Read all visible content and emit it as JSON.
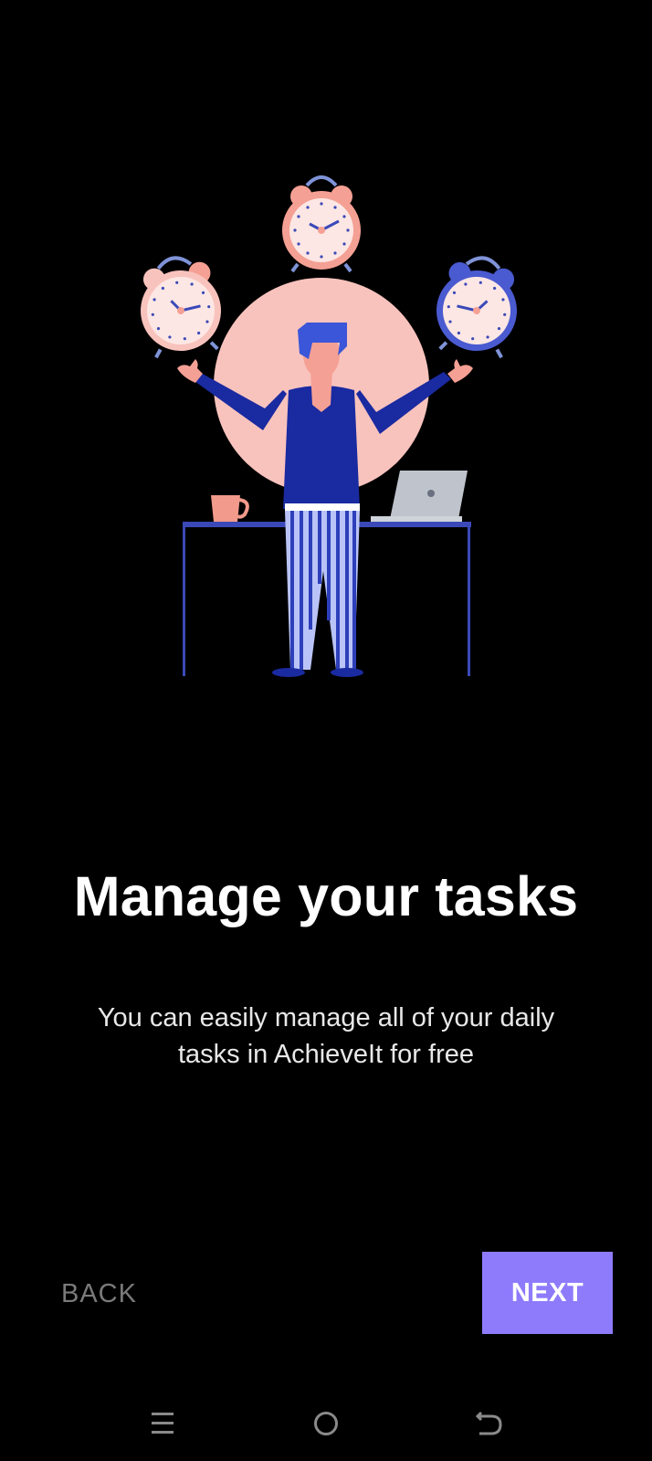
{
  "onboarding": {
    "title": "Manage your tasks",
    "subtitle": "You can easily manage all of your daily tasks in AchieveIt for free",
    "back_label": "BACK",
    "next_label": "NEXT"
  },
  "illustration": {
    "subject": "person-juggling-alarm-clocks-at-desk"
  },
  "navbar": {
    "icons": [
      "menu-icon",
      "home-icon",
      "back-icon"
    ]
  },
  "colors": {
    "background": "#000000",
    "accent": "#8e7bfb",
    "title": "#ffffff",
    "subtitle": "#e8e8e8",
    "back_text": "#7a7a7a",
    "illustration_pink": "#f5a094",
    "illustration_blue": "#1a2aa0",
    "illustration_circle": "#f9c3bd"
  }
}
